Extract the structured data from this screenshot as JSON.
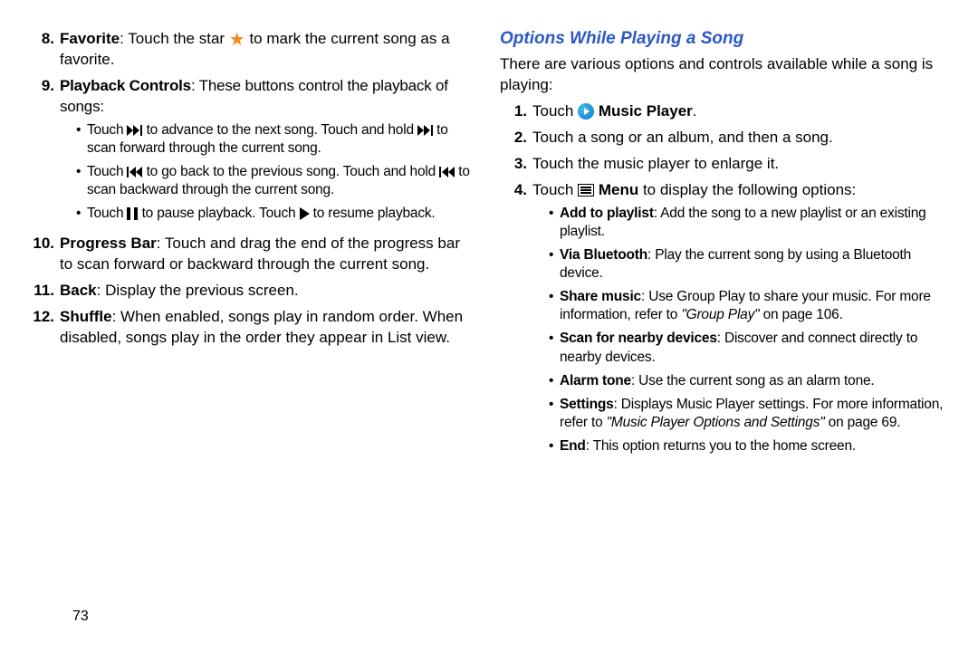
{
  "pageNumber": "73",
  "left": {
    "items": [
      {
        "num": "8.",
        "label": "Favorite",
        "text_a": ": Touch the star ",
        "text_b": " to mark the current song as a favorite."
      },
      {
        "num": "9.",
        "label": "Playback Controls",
        "text_a": ": These buttons control the playback of songs:",
        "sub": [
          {
            "a": "Touch ",
            "b": " to advance to the next song. Touch and hold ",
            "c": "  to scan forward through the current song."
          },
          {
            "a": "Touch ",
            "b": " to go back to the previous song. Touch and hold ",
            "c": "  to scan backward through the current song."
          },
          {
            "a": "Touch ",
            "b": " to pause playback. Touch ",
            "c": " to resume playback."
          }
        ]
      },
      {
        "num": "10.",
        "label": "Progress Bar",
        "text_a": ": Touch and drag the end of the progress bar to scan forward or backward through the current song."
      },
      {
        "num": "11.",
        "label": "Back",
        "text_a": ": Display the previous screen."
      },
      {
        "num": "12.",
        "label": "Shuffle",
        "text_a": ": When enabled, songs play in random order. When disabled, songs play in the order they appear in List view."
      }
    ]
  },
  "right": {
    "heading": "Options While Playing a Song",
    "intro": "There are various options and controls available while a song is playing:",
    "steps": [
      {
        "num": "1.",
        "a": "Touch ",
        "b": "Music Player",
        "c": "."
      },
      {
        "num": "2.",
        "text": "Touch a song or an album, and then a song."
      },
      {
        "num": "3.",
        "text": "Touch the music player to enlarge it."
      },
      {
        "num": "4.",
        "a": "Touch ",
        "b": "Menu",
        "c": " to display the following options:"
      }
    ],
    "opts": [
      {
        "label": "Add to playlist",
        "text": ": Add the song to a new playlist or an existing playlist."
      },
      {
        "label": "Via Bluetooth",
        "text": ": Play the current song by using a Bluetooth device."
      },
      {
        "label": "Share music",
        "text": ": Use Group Play to share your music. For more information, refer to ",
        "ref": "\"Group Play\"",
        "tail": " on page 106."
      },
      {
        "label": "Scan for nearby devices",
        "text": ": Discover and connect directly to nearby devices."
      },
      {
        "label": "Alarm tone",
        "text": ": Use the current song as an alarm tone."
      },
      {
        "label": "Settings",
        "text": ": Displays Music Player settings. For more information, refer to ",
        "ref": "\"Music Player Options and Settings\"",
        "tail": " on page 69."
      },
      {
        "label": "End",
        "text": ": This option returns you to the home screen."
      }
    ]
  }
}
